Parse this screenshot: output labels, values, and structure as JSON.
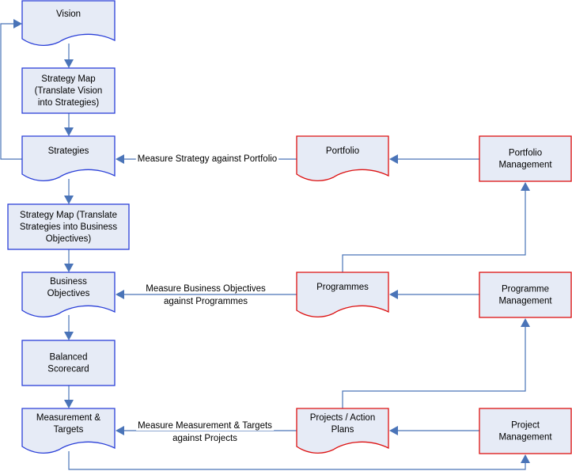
{
  "diagram": {
    "nodes": {
      "vision": {
        "lines": [
          "Vision"
        ],
        "shape": "document",
        "border": "blue"
      },
      "strategy_map_1": {
        "lines": [
          "Strategy Map",
          "(Translate Vision",
          "into Strategies)"
        ],
        "shape": "process",
        "border": "blue"
      },
      "strategies": {
        "lines": [
          "Strategies"
        ],
        "shape": "document",
        "border": "blue"
      },
      "strategy_map_2": {
        "lines": [
          "Strategy Map (Translate",
          "Strategies into Business",
          "Objectives)"
        ],
        "shape": "process",
        "border": "blue"
      },
      "business_objectives": {
        "lines": [
          "Business",
          "Objectives"
        ],
        "shape": "document",
        "border": "blue"
      },
      "balanced_scorecard": {
        "lines": [
          "Balanced",
          "Scorecard"
        ],
        "shape": "process",
        "border": "blue"
      },
      "measurement_targets": {
        "lines": [
          "Measurement &",
          "Targets"
        ],
        "shape": "document",
        "border": "blue"
      },
      "portfolio": {
        "lines": [
          "Portfolio"
        ],
        "shape": "document",
        "border": "red"
      },
      "portfolio_management": {
        "lines": [
          "Portfolio",
          "Management"
        ],
        "shape": "process",
        "border": "red"
      },
      "programmes": {
        "lines": [
          "Programmes"
        ],
        "shape": "document",
        "border": "red"
      },
      "programme_management": {
        "lines": [
          "Programme",
          "Management"
        ],
        "shape": "process",
        "border": "red"
      },
      "projects_action_plans": {
        "lines": [
          "Projects / Action",
          "Plans"
        ],
        "shape": "document",
        "border": "red"
      },
      "project_management": {
        "lines": [
          "Project",
          "Management"
        ],
        "shape": "process",
        "border": "red"
      }
    },
    "edges": [
      {
        "from": "vision",
        "to": "strategy_map_1",
        "label": []
      },
      {
        "from": "strategy_map_1",
        "to": "strategies",
        "label": []
      },
      {
        "from": "strategies",
        "to": "vision",
        "label": []
      },
      {
        "from": "strategies",
        "to": "strategy_map_2",
        "label": []
      },
      {
        "from": "strategy_map_2",
        "to": "business_objectives",
        "label": []
      },
      {
        "from": "business_objectives",
        "to": "balanced_scorecard",
        "label": []
      },
      {
        "from": "balanced_scorecard",
        "to": "measurement_targets",
        "label": []
      },
      {
        "from": "portfolio",
        "to": "strategies",
        "label": [
          "Measure Strategy against Portfolio"
        ]
      },
      {
        "from": "portfolio_management",
        "to": "portfolio",
        "label": []
      },
      {
        "from": "programmes",
        "to": "business_objectives",
        "label": [
          "Measure Business Objectives",
          "against Programmes"
        ]
      },
      {
        "from": "programme_management",
        "to": "programmes",
        "label": []
      },
      {
        "from": "programmes",
        "to": "portfolio_management",
        "label": []
      },
      {
        "from": "projects_action_plans",
        "to": "measurement_targets",
        "label": [
          "Measure Measurement & Targets",
          "against Projects"
        ]
      },
      {
        "from": "project_management",
        "to": "projects_action_plans",
        "label": []
      },
      {
        "from": "projects_action_plans",
        "to": "programme_management",
        "label": []
      },
      {
        "from": "measurement_targets",
        "to": "project_management",
        "label": []
      }
    ],
    "colors": {
      "fill": "#e6ebf6",
      "border_blue": "#2a3fd8",
      "border_red": "#dd1111",
      "connector": "#4a74b8"
    }
  }
}
